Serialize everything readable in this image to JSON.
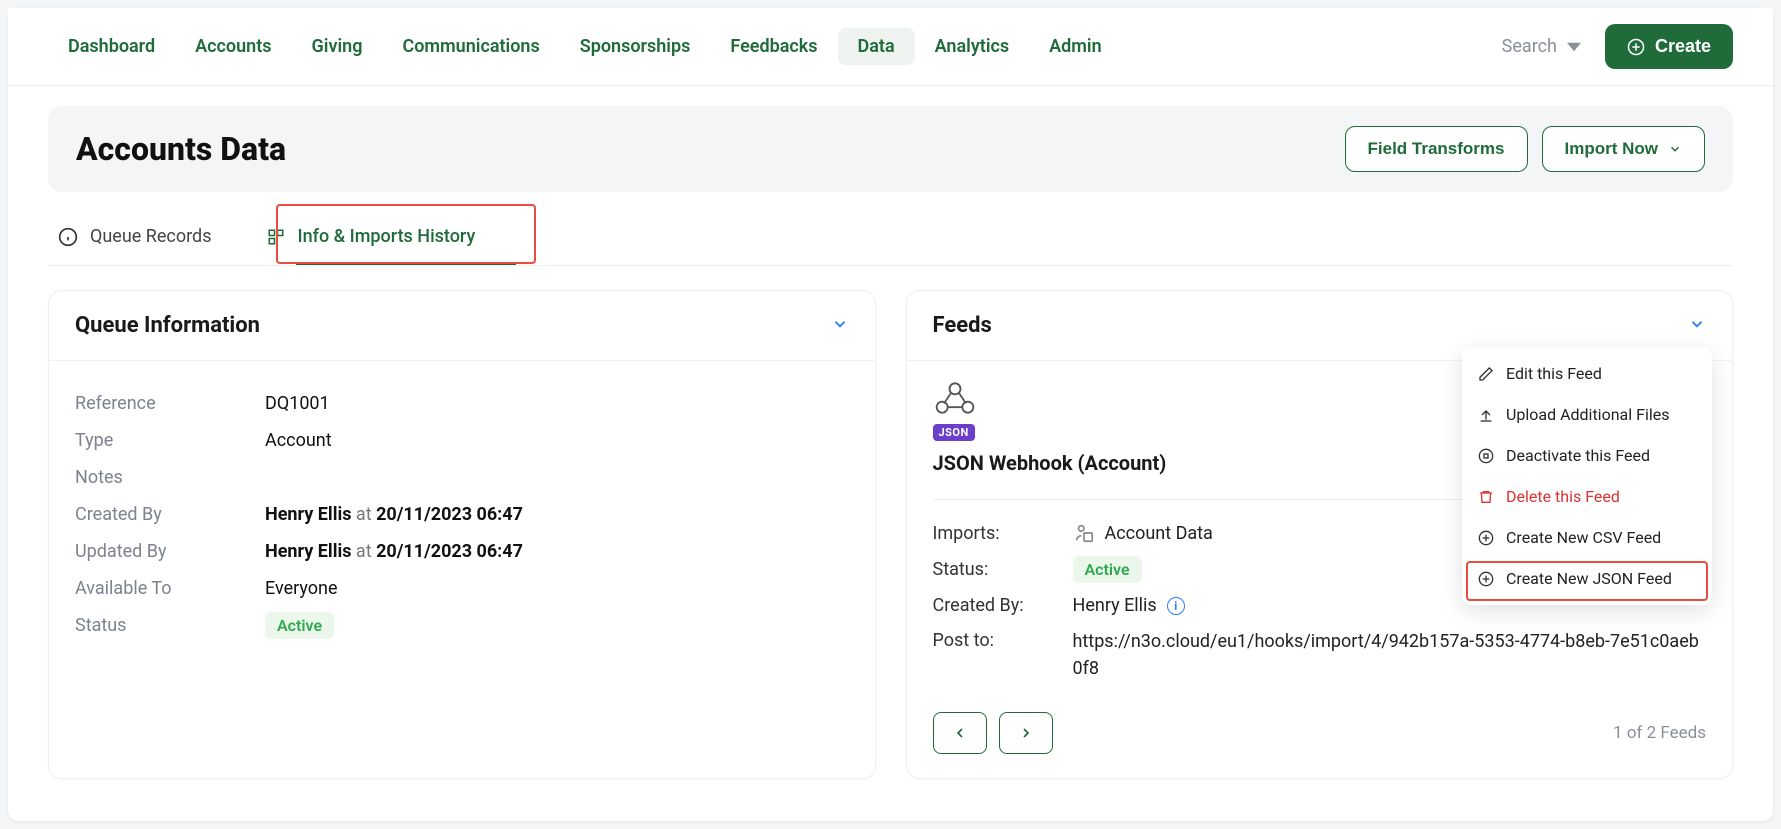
{
  "nav": {
    "items": [
      "Dashboard",
      "Accounts",
      "Giving",
      "Communications",
      "Sponsorships",
      "Feedbacks",
      "Data",
      "Analytics",
      "Admin"
    ],
    "active_index": 6,
    "search_label": "Search",
    "create_label": "Create"
  },
  "page": {
    "title": "Accounts Data",
    "btn_field_transforms": "Field Transforms",
    "btn_import_now": "Import Now"
  },
  "tabs": {
    "queue_records": "Queue Records",
    "info_imports": "Info & Imports History"
  },
  "queue_info": {
    "title": "Queue Information",
    "labels": {
      "reference": "Reference",
      "type": "Type",
      "notes": "Notes",
      "created_by": "Created By",
      "updated_by": "Updated By",
      "available_to": "Available To",
      "status": "Status"
    },
    "values": {
      "reference": "DQ1001",
      "type": "Account",
      "notes": "",
      "created_by_name": "Henry Ellis",
      "created_by_at": " at ",
      "created_by_time": "20/11/2023 06:47",
      "updated_by_name": "Henry Ellis",
      "updated_by_at": " at ",
      "updated_by_time": "20/11/2023 06:47",
      "available_to": "Everyone",
      "status": "Active"
    }
  },
  "feeds": {
    "title": "Feeds",
    "json_tag": "JSON",
    "feed_title": "JSON Webhook (Account)",
    "labels": {
      "imports": "Imports:",
      "status": "Status:",
      "created_by": "Created By:",
      "post_to": "Post to:"
    },
    "values": {
      "imports": "Account Data",
      "status": "Active",
      "created_by": "Henry Ellis",
      "post_to": "https://n3o.cloud/eu1/hooks/import/4/942b157a-5353-4774-b8eb-7e51c0aeb0f8"
    },
    "pager_text": "1 of 2 Feeds"
  },
  "dropdown": {
    "edit": "Edit this Feed",
    "upload": "Upload Additional Files",
    "deactivate": "Deactivate this Feed",
    "delete": "Delete this Feed",
    "create_csv": "Create New CSV Feed",
    "create_json": "Create New JSON Feed"
  }
}
